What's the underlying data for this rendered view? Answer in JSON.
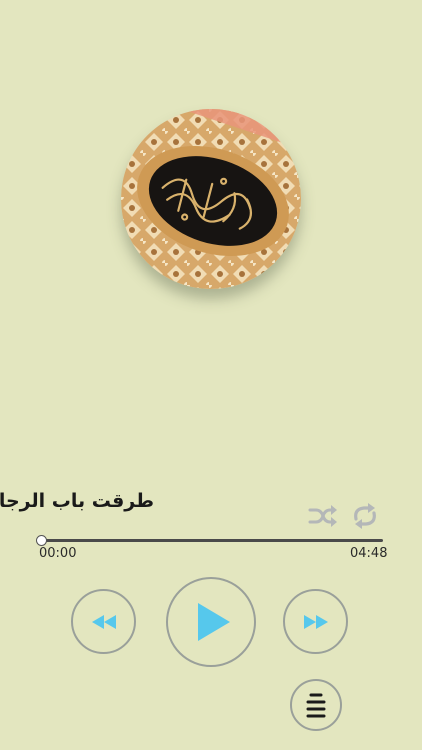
{
  "player": {
    "track_title": "طرقت باب الرجاء",
    "elapsed": "00:00",
    "duration": "04:48",
    "progress_fraction": 0.0
  },
  "icons": {
    "shuffle": "shuffle-icon",
    "repeat": "repeat-icon",
    "rewind": "rewind-icon",
    "play": "play-icon",
    "forward": "fast-forward-icon",
    "playlist": "playlist-icon"
  },
  "colors": {
    "background": "#e3e6bf",
    "accent": "#56c8ec",
    "button_ring": "#9aa09a",
    "muted_icon": "#b4b7b8",
    "text": "#1a1a1a"
  }
}
